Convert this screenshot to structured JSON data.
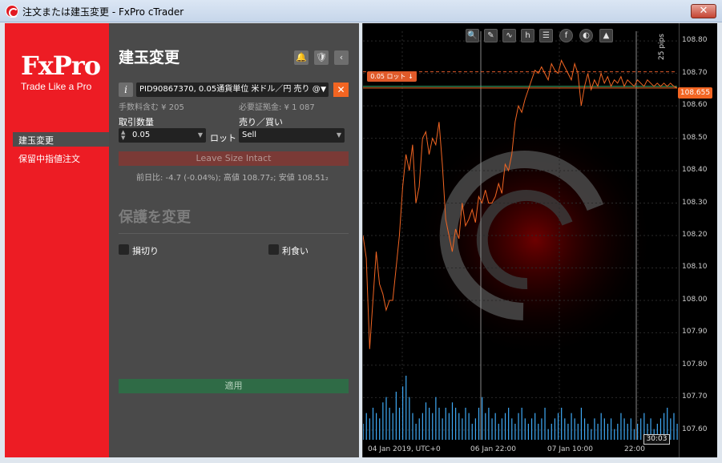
{
  "window": {
    "title": "注文または建玉変更 - FxPro cTrader",
    "close_label": "✕"
  },
  "sidebar": {
    "logo": "FxPro",
    "tagline": "Trade Like a Pro",
    "items": [
      {
        "label": "建玉変更",
        "active": true
      },
      {
        "label": "保留中指値注文",
        "active": false
      }
    ]
  },
  "form": {
    "title": "建玉変更",
    "position_select": "PID90867370, 0.05通貨単位 米ドル／円 売り @",
    "commission": "手数料含む ¥ 205",
    "margin": "必要証拠金: ¥ 1 087",
    "quantity_label": "取引数量",
    "quantity_value": "0.05",
    "quantity_unit": "ロット",
    "side_label": "売り／買い",
    "side_value": "Sell",
    "leave_size_label": "Leave Size Intact",
    "stats": "前日比: -4.7 (-0.04%); 高値 108.77₂; 安値 108.51₂",
    "protection_title": "保護を変更",
    "stop_loss_label": "損切り",
    "take_profit_label": "利食い",
    "apply_label": "適用"
  },
  "chart_data": {
    "type": "line",
    "symbol": "USDJPY",
    "y_ticks": [
      "108.80",
      "108.70",
      "108.60",
      "108.50",
      "108.40",
      "108.30",
      "108.20",
      "108.10",
      "108.00",
      "107.90",
      "107.80",
      "107.70",
      "107.60"
    ],
    "ylim": [
      107.57,
      108.83
    ],
    "x_labels": [
      "04 Jan 2019, UTC+0",
      "06 Jan 22:00",
      "07 Jan 10:00",
      "22:00"
    ],
    "current_price": "108.655",
    "position_tag": "0.05 ロット ↓",
    "position_price": 108.705,
    "pips_label": "25 pips",
    "time_cursor": "30:03",
    "x": [
      0,
      1,
      2,
      3,
      4,
      5,
      6,
      7,
      8,
      9,
      10,
      11,
      12,
      13,
      14,
      15,
      16,
      17,
      18,
      19,
      20,
      21,
      22,
      23,
      24,
      25,
      26,
      27,
      28,
      29,
      30,
      31,
      32,
      33,
      34,
      35,
      36,
      37,
      38,
      39,
      40,
      41,
      42,
      43,
      44,
      45,
      46,
      47,
      48,
      49,
      50,
      51,
      52,
      53,
      54,
      55,
      56,
      57,
      58,
      59,
      60,
      61,
      62,
      63,
      64,
      65,
      66,
      67,
      68,
      69,
      70,
      71,
      72,
      73,
      74,
      75,
      76,
      77,
      78,
      79,
      80,
      81,
      82,
      83,
      84,
      85,
      86,
      87,
      88,
      89,
      90,
      91,
      92,
      93,
      94,
      95
    ],
    "values": [
      108.2,
      108.13,
      107.85,
      108.0,
      108.15,
      108.05,
      108.02,
      107.97,
      108.0,
      108.0,
      108.1,
      108.2,
      108.35,
      108.45,
      108.4,
      108.48,
      108.3,
      108.35,
      108.5,
      108.52,
      108.45,
      108.5,
      108.48,
      108.55,
      108.42,
      108.25,
      108.2,
      108.15,
      108.22,
      108.19,
      108.3,
      108.23,
      108.25,
      108.28,
      108.24,
      108.32,
      108.3,
      108.34,
      108.3,
      108.3,
      108.32,
      108.36,
      108.33,
      108.42,
      108.4,
      108.45,
      108.55,
      108.6,
      108.58,
      108.62,
      108.65,
      108.68,
      108.71,
      108.7,
      108.72,
      108.7,
      108.68,
      108.73,
      108.71,
      108.7,
      108.74,
      108.72,
      108.7,
      108.68,
      108.73,
      108.7,
      108.6,
      108.66,
      108.7,
      108.65,
      108.68,
      108.66,
      108.7,
      108.67,
      108.69,
      108.66,
      108.68,
      108.67,
      108.69,
      108.66,
      108.68,
      108.67,
      108.66,
      108.68,
      108.67,
      108.66,
      108.68,
      108.67,
      108.66,
      108.67,
      108.66,
      108.67,
      108.66,
      108.67,
      108.66,
      108.655
    ],
    "volume": [
      3,
      5,
      4,
      6,
      5,
      4,
      7,
      8,
      6,
      5,
      9,
      6,
      10,
      12,
      8,
      5,
      3,
      4,
      5,
      7,
      6,
      5,
      8,
      6,
      4,
      6,
      5,
      7,
      6,
      5,
      4,
      6,
      5,
      3,
      4,
      6,
      8,
      5,
      6,
      4,
      5,
      3,
      4,
      5,
      6,
      4,
      3,
      5,
      6,
      4,
      3,
      4,
      5,
      3,
      4,
      6,
      2,
      3,
      4,
      5,
      6,
      4,
      3,
      5,
      4,
      3,
      6,
      4,
      3,
      2,
      4,
      3,
      5,
      4,
      3,
      4,
      2,
      3,
      5,
      4,
      3,
      4,
      2,
      3,
      4,
      5,
      3,
      4,
      2,
      3,
      4,
      5,
      6,
      4,
      5,
      3
    ],
    "grid": true
  },
  "colors": {
    "brand": "#ed1c24",
    "accent": "#f26522",
    "line": "#f26522",
    "volume": "#3fa9f5"
  }
}
